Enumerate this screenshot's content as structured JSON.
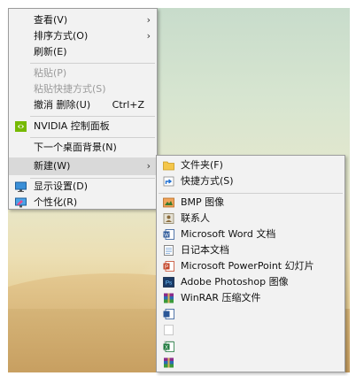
{
  "context_menu": {
    "items": [
      {
        "label": "查看(V)"
      },
      {
        "label": "排序方式(O)"
      },
      {
        "label": "刷新(E)"
      },
      {
        "label": "粘贴(P)"
      },
      {
        "label": "粘贴快捷方式(S)"
      },
      {
        "label": "撤消 删除(U)",
        "shortcut": "Ctrl+Z"
      },
      {
        "label": "NVIDIA 控制面板",
        "icon": "nvidia-icon"
      },
      {
        "label": "下一个桌面背景(N)"
      },
      {
        "label": "新建(W)"
      },
      {
        "label": "显示设置(D)",
        "icon": "display-settings-icon"
      },
      {
        "label": "个性化(R)",
        "icon": "personalize-icon"
      }
    ],
    "submenu_arrow": "›"
  },
  "new_submenu": {
    "items": [
      {
        "label": "文件夹(F)",
        "icon": "folder-icon"
      },
      {
        "label": "快捷方式(S)",
        "icon": "shortcut-icon"
      },
      {
        "label": "BMP 图像",
        "icon": "bmp-image-icon"
      },
      {
        "label": "联系人",
        "icon": "contact-icon"
      },
      {
        "label": "Microsoft Word 文档",
        "icon": "word-document-icon"
      },
      {
        "label": "日记本文档",
        "icon": "journal-document-icon"
      },
      {
        "label": "Microsoft PowerPoint 幻灯片",
        "icon": "powerpoint-icon"
      },
      {
        "label": "Adobe Photoshop 图像",
        "icon": "photoshop-image-icon"
      },
      {
        "label": "WinRAR 压缩文件",
        "icon": "winrar-archive-icon"
      }
    ],
    "obscured_items": [
      {
        "icon": "word-document-icon"
      },
      {
        "icon": "text-document-icon"
      },
      {
        "icon": "blank-document-icon"
      },
      {
        "icon": "excel-spreadsheet-icon"
      },
      {
        "icon": "winrar-zip-icon"
      }
    ]
  },
  "colors": {
    "menu_background": "#f2f2f2",
    "highlight": "#d9d9d9",
    "disabled_text": "#9a9a9a",
    "nvidia_green": "#76b900",
    "folder_yellow": "#f4c64a"
  }
}
